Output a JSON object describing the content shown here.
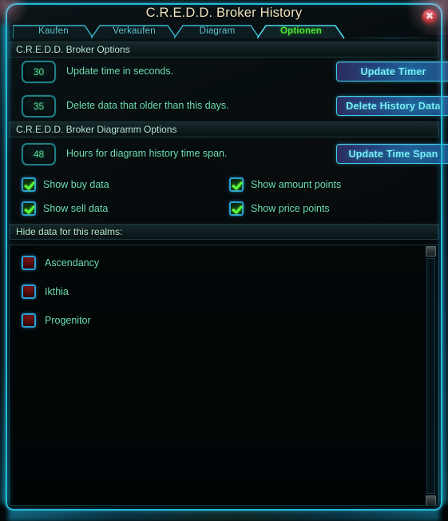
{
  "window": {
    "title": "C.R.E.D.D. Broker History",
    "close_icon": "close-icon",
    "close_glyph": "✖"
  },
  "tabs": [
    {
      "label": "Kaufen",
      "active": false
    },
    {
      "label": "Verkaufen",
      "active": false
    },
    {
      "label": "Diagram",
      "active": false
    },
    {
      "label": "Optionen",
      "active": true
    }
  ],
  "sections": {
    "broker_options": {
      "header": "C.R.E.D.D. Broker Options",
      "rows": [
        {
          "value": "30",
          "label": "Update time in seconds.",
          "button": "Update Timer"
        },
        {
          "value": "35",
          "label": "Delete data that older than this days.",
          "button": "Delete History Data"
        }
      ]
    },
    "diagram_options": {
      "header": "C.R.E.D.D. Broker Diagramm Options",
      "rows": [
        {
          "value": "48",
          "label": "Hours for diagram history time span.",
          "button": "Update Time Span"
        }
      ],
      "checkboxes": [
        {
          "label": "Show buy data",
          "checked": true
        },
        {
          "label": "Show sell data",
          "checked": true
        },
        {
          "label": "Show amount points",
          "checked": true
        },
        {
          "label": "Show price points",
          "checked": true
        }
      ]
    },
    "realms": {
      "header": "Hide data for this realms:",
      "items": [
        {
          "label": "Ascendancy",
          "checked": false
        },
        {
          "label": "Ikthia",
          "checked": false
        },
        {
          "label": "Progenitor",
          "checked": false
        }
      ]
    }
  },
  "scrollbar": {
    "up_icon": "scroll-up-icon",
    "down_icon": "scroll-down-icon"
  },
  "colors": {
    "accent_cyan": "#3fd0e8",
    "frame_border": "#24b8d6",
    "title_text": "#efe3bb",
    "label_green": "#6de0b2",
    "active_tab_green": "#4fe23a",
    "button_text": "#7bf0ff",
    "checkbox_on": "#5dfc3a",
    "checkbox_off": "#8e1616",
    "close_red": "#cc2222"
  }
}
